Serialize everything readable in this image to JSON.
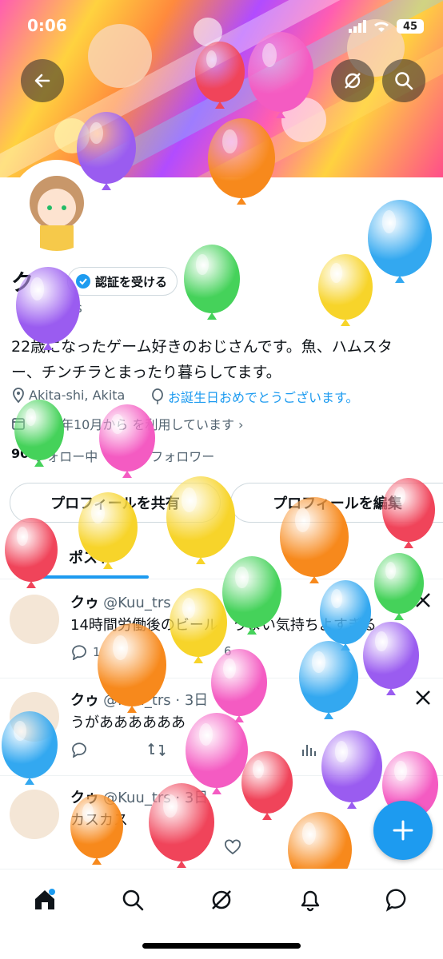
{
  "status_bar": {
    "time": "0:06",
    "battery": "45"
  },
  "profile": {
    "name_visible": "ク",
    "verify_label": "認証を受ける",
    "handle_visible": "s",
    "bio_line1": "22歳になったゲーム好きのおじさんです。魚、ハムスタ",
    "bio_line2": "ー、チンチラとまったり暮らしてます。",
    "location": "Akita-shi, Akita",
    "birthday": "お誕生日おめでとうございます。",
    "joined": "年10月から を利用しています ›",
    "following_count": "90",
    "following_label": "フォロー中",
    "followers_label": "フォロワー",
    "share_button": "プロフィールを共有",
    "edit_button": "プロフィールを編集"
  },
  "tabs": {
    "posts": "ポスト"
  },
  "tweets": [
    {
      "name": "クゥ",
      "handle": "@Kuu_trs",
      "text": "14時間労働後のビール。うまい気持ちよすぎる",
      "reply_count": "1",
      "like_count": "6"
    },
    {
      "name": "クゥ",
      "handle": "@Kuu_trs · 3日",
      "text": "うがああああああ"
    },
    {
      "name": "クゥ",
      "handle": "@Kuu_trs · 3日",
      "text": "カスカス"
    }
  ],
  "icons": [
    "back-arrow-icon",
    "grok-icon",
    "search-icon",
    "verified-badge-icon",
    "location-icon",
    "balloon-icon",
    "calendar-icon",
    "home-icon",
    "explore-icon",
    "grok-nav-icon",
    "bell-icon",
    "messages-icon",
    "compose-icon",
    "x-logo-icon"
  ],
  "colors": {
    "accent": "#1d9bf0",
    "text": "#0f1419",
    "muted": "#536471"
  }
}
